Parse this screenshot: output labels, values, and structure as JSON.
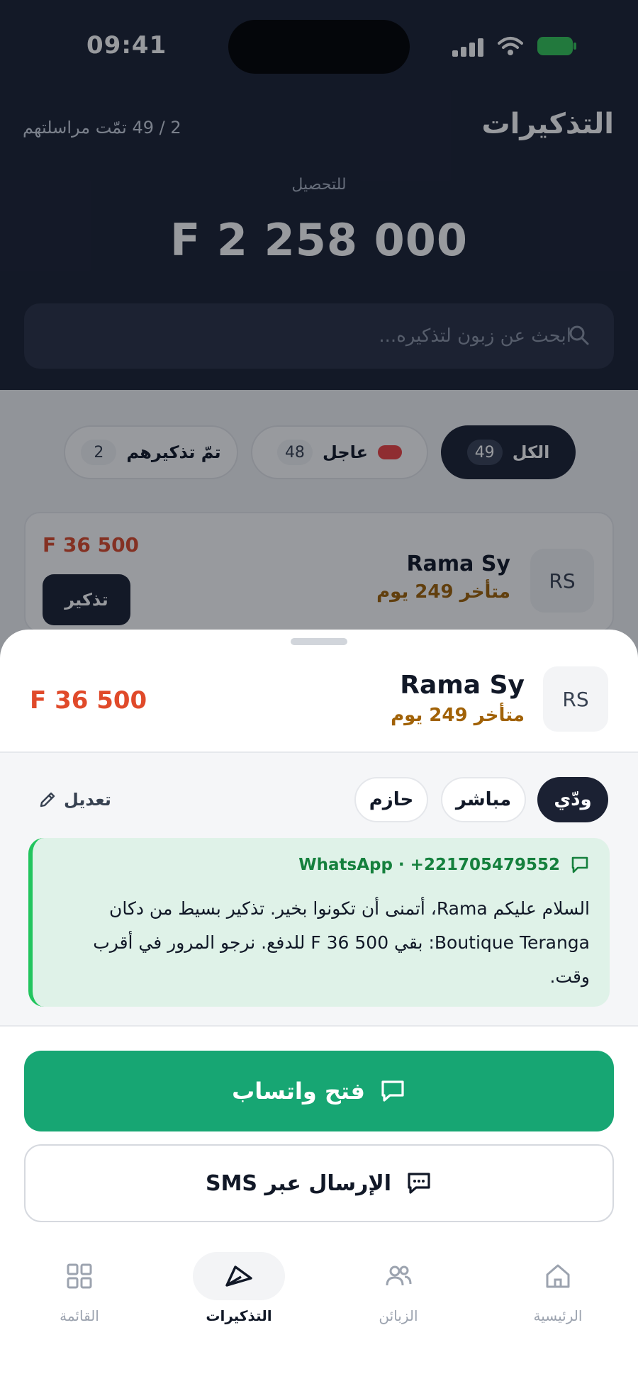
{
  "status_bar": {
    "time": "09:41"
  },
  "header": {
    "title": "التذكيرات",
    "progress": "2 / 49 تمّت مراسلتهم",
    "to_collect_label": "للتحصيل",
    "to_collect_amount": "F 2 258 000"
  },
  "search": {
    "placeholder": "ابحث عن زبون لتذكيره..."
  },
  "filters": [
    {
      "label": "الكل",
      "count": "49"
    },
    {
      "label": "عاجل",
      "count": "48"
    },
    {
      "label": "تمّ تذكيرهم",
      "count": "2"
    }
  ],
  "card": {
    "initials": "RS",
    "name": "Rama Sy",
    "overdue": "متأخر 249 يوم",
    "amount": "F 36 500",
    "remind_label": "تذكير"
  },
  "sheet": {
    "initials": "RS",
    "name": "Rama Sy",
    "overdue": "متأخر 249 يوم",
    "amount": "F 36 500",
    "tones": [
      "ودّي",
      "مباشر",
      "حازم"
    ],
    "edit_label": "تعديل",
    "message": {
      "channel": "WhatsApp · +221705479552",
      "body": "السلام عليكم Rama، أتمنى أن تكونوا بخير. تذكير بسيط من دكان Boutique Teranga: بقي F 36 500 للدفع. نرجو المرور في أقرب وقت."
    },
    "whatsapp_button": "فتح واتساب",
    "sms_button": "الإرسال عبر SMS"
  },
  "nav": {
    "home": "الرئيسية",
    "customers": "الزبائن",
    "reminders": "التذكيرات",
    "menu": "القائمة"
  },
  "colors": {
    "header_bg": "#1b2133",
    "whatsapp_green": "#17a673",
    "amount_red": "#e04a2a",
    "overdue_amber": "#a16207",
    "message_bg": "#dff2e8"
  }
}
